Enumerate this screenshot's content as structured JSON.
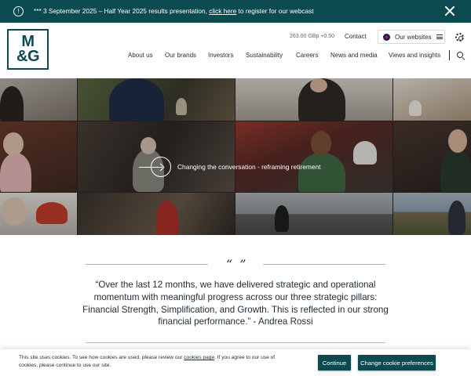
{
  "announcement": {
    "prefix": "*** 3 September 2025 – Half Year 2025 results presentation, ",
    "link": "click here",
    "suffix": " to register for our webcast",
    "info_icon": "info-icon",
    "close_icon": "close-icon"
  },
  "header": {
    "logo_line1": "M",
    "logo_line2": "&G",
    "share_price": "263.00 GBp +0.50",
    "contact": "Contact",
    "websites": "Our websites",
    "nav": [
      "About us",
      "Our brands",
      "Investors",
      "Sustainability",
      "Careers",
      "News and media",
      "Views and insights"
    ]
  },
  "hero": {
    "caption": "Changing the conversation - reframing retirement"
  },
  "quote": {
    "mark": "“ ”",
    "text": "“Over the last 12 months, we have delivered strategic and operational momentum with meaningful progress across our three strategic pillars: Financial Strength, Simplification, and Growth. This is reflected in our strong financial performance.” - Andrea Rossi"
  },
  "cookie": {
    "msg_prefix": "This site uses cookies. To see how cookies are used, please review our ",
    "msg_link": "cookies page",
    "msg_suffix": ". If you agree to our use of cookies, please continue to use our site.",
    "continue": "Continue",
    "preferences": "Change cookie preferences"
  },
  "colors": {
    "brand": "#0b4a4f",
    "accent_line": "#e3a58e"
  }
}
